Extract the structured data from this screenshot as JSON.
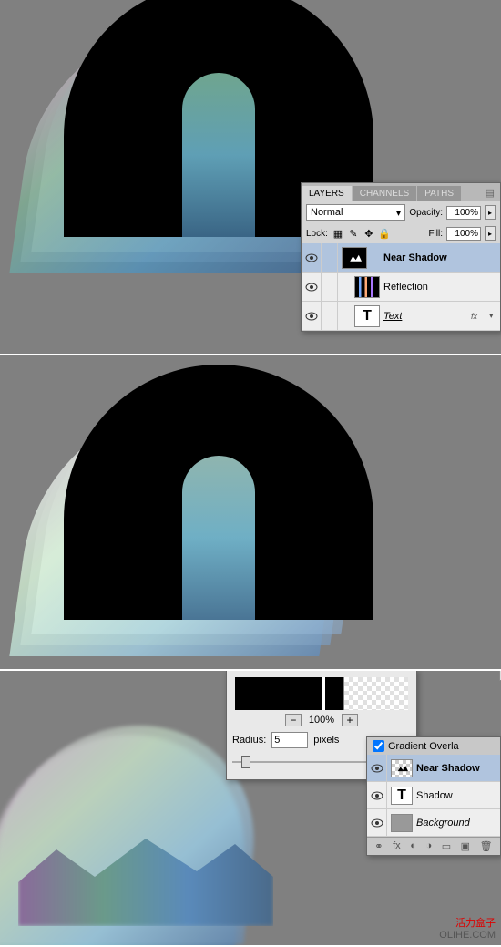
{
  "panel1": {
    "tabs": [
      "LAYERS",
      "CHANNELS",
      "PATHS"
    ],
    "blend": "Normal",
    "opacity_label": "Opacity:",
    "opacity": "100%",
    "lock_label": "Lock:",
    "fill_label": "Fill:",
    "fill": "100%",
    "layers": [
      {
        "name": "Near Shadow",
        "bold": true,
        "thumb": "t1",
        "sel": true
      },
      {
        "name": "Reflection",
        "thumb": "stripe"
      },
      {
        "name": "Text",
        "thumb": "T",
        "italic": true,
        "fx": "fx"
      }
    ]
  },
  "dialog": {
    "zoom": "100%",
    "radius_label": "Radius:",
    "radius_value": "5",
    "radius_unit": "pixels"
  },
  "panel3": {
    "gradient_label": "Gradient Overla",
    "layers": [
      {
        "name": "Near Shadow",
        "bold": true,
        "thumb": "checker",
        "sel": true
      },
      {
        "name": "Shadow",
        "thumb": "T"
      },
      {
        "name": "Background",
        "thumb": "gray",
        "italic": true
      }
    ]
  },
  "overla": "verla",
  "watermark": {
    "cn": "活力盒子",
    "en": "OLIHE.COM"
  }
}
